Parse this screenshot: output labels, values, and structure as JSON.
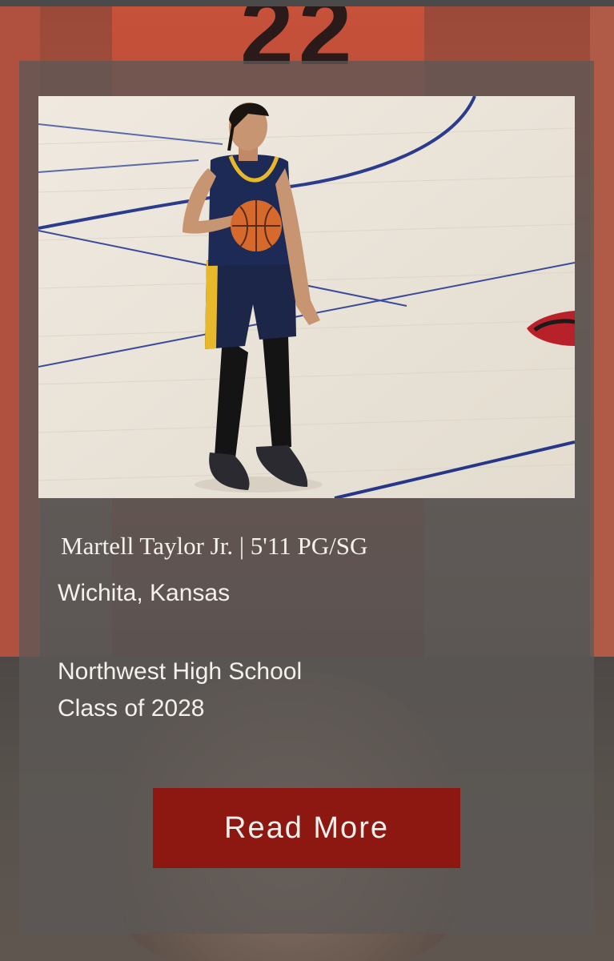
{
  "player": {
    "name_line": "Martell Taylor Jr. | 5'11 PG/SG",
    "location": "Wichita, Kansas",
    "school": "Northwest High School",
    "class_year": "Class of 2028"
  },
  "actions": {
    "read_more_label": "Read More"
  },
  "background": {
    "jersey_number": "22"
  },
  "colors": {
    "button_bg": "#8c1811",
    "card_overlay": "rgba(92,88,86,0.78)",
    "text": "#f4f1ec"
  }
}
